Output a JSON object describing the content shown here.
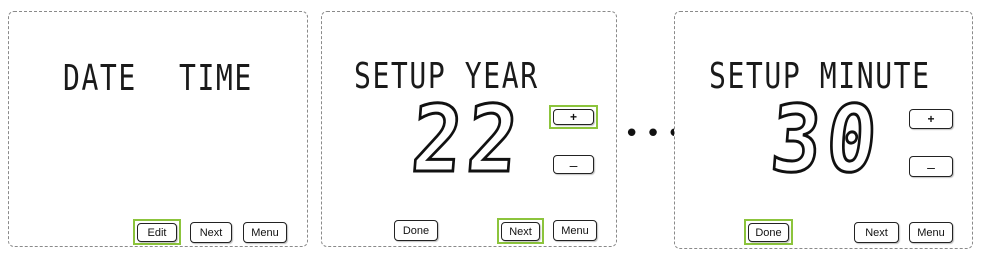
{
  "screens": [
    {
      "title_left": "DATE",
      "title_right": "TIME",
      "buttons": {
        "edit": "Edit",
        "next": "Next",
        "menu": "Menu"
      },
      "highlighted": "edit"
    },
    {
      "title": "SETUP YEAR",
      "value": "22",
      "buttons": {
        "plus": "+",
        "minus": "–",
        "done": "Done",
        "next": "Next",
        "menu": "Menu"
      },
      "highlighted": [
        "plus",
        "next"
      ]
    },
    {
      "title": "SETUP MINUTE",
      "value": "30",
      "buttons": {
        "plus": "+",
        "minus": "–",
        "done": "Done",
        "next": "Next",
        "menu": "Menu"
      },
      "highlighted": "done"
    }
  ],
  "separator": "•••",
  "colors": {
    "highlight": "#8cc43c",
    "text": "#111111",
    "border": "#8a8a8a"
  }
}
